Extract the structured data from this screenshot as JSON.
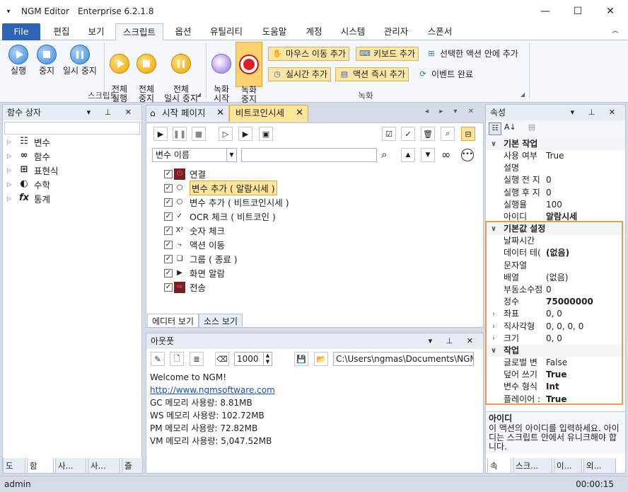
{
  "window": {
    "app": "NGM Editor",
    "edition": "Enterprise 6.2.1.8",
    "menu_icon": "dropdown-icon"
  },
  "menu": {
    "tabs": [
      "File",
      "편집",
      "보기",
      "스크립트",
      "옵션",
      "유틸리티",
      "도움말",
      "계정",
      "시스템",
      "관리자",
      "스폰서"
    ],
    "active": "스크립트"
  },
  "ribbon": {
    "script": {
      "run": "실행",
      "stop": "중지",
      "pause": "일시 중지",
      "run_all": "전체\n실행",
      "stop_all": "전체\n중지",
      "pause_all": "전체\n일시 중지",
      "group": "스크립트"
    },
    "record": {
      "start": "녹화\n시작",
      "stop": "녹화\n중지",
      "mouse": "마우스 이동 추가",
      "keyboard": "키보드 추가",
      "inside": "선택한 액션 안에 추가",
      "realtime": "실시간 추가",
      "instant": "액션 즉시 추가",
      "event_done": "이벤트 완료",
      "group": "녹화"
    }
  },
  "left_panel": {
    "title": "함수 상자",
    "items": [
      {
        "label": "변수",
        "icon": "variable-icon"
      },
      {
        "label": "함수",
        "icon": "function-icon"
      },
      {
        "label": "표현식",
        "icon": "expression-icon"
      },
      {
        "label": "수학",
        "icon": "math-icon"
      },
      {
        "label": "통계",
        "icon": "statistics-icon"
      }
    ],
    "bottom_tabs": [
      "도",
      "함",
      "사...",
      "사...",
      "즐"
    ]
  },
  "doc_tabs": [
    {
      "label": "시작 페이지",
      "icon": "home-icon"
    },
    {
      "label": "비트코인시세",
      "icon": ""
    }
  ],
  "editor": {
    "var_select": "변수 이름",
    "search_value": "",
    "lines": [
      {
        "label": "연결",
        "icon": "connect-icon",
        "checked": true,
        "highlight": false
      },
      {
        "label": "변수 추가 ( 알람시세 )",
        "icon": "cube-icon",
        "checked": true,
        "highlight": true
      },
      {
        "label": "변수 추가 ( 비트코인시세 )",
        "icon": "cube-icon",
        "checked": true,
        "highlight": false
      },
      {
        "label": "OCR 체크 ( 비트코인 )",
        "icon": "ocr-icon",
        "checked": true,
        "highlight": false
      },
      {
        "label": "숫자 체크",
        "icon": "number-check-icon",
        "checked": true,
        "highlight": false
      },
      {
        "label": "액션 이동",
        "icon": "action-move-icon",
        "checked": true,
        "highlight": false
      },
      {
        "label": "그룹 ( 종료 )",
        "icon": "group-icon",
        "checked": true,
        "highlight": false
      },
      {
        "label": "화면 알람",
        "icon": "screen-alarm-icon",
        "checked": true,
        "highlight": false
      },
      {
        "label": "전송",
        "icon": "send-icon",
        "checked": true,
        "highlight": false
      }
    ],
    "view_tabs": [
      "에디터 보기",
      "소스 보기"
    ]
  },
  "output": {
    "title": "아웃풋",
    "limit": "1000",
    "path": "C:\\Users\\ngmas\\Documents\\NGM6\\",
    "lines": [
      "Welcome to NGM!",
      "http://www.ngmsoftware.com",
      "GC 메모리 사용량: 8.81MB",
      "WS 메모리 사용량: 102.72MB",
      "PM 메모리 사용량: 72.82MB",
      "VM 메모리 사용량: 5,047.52MB"
    ]
  },
  "properties": {
    "title": "속성",
    "cat1": "기본 작업",
    "basic": [
      {
        "n": "사용 여부",
        "v": "True"
      },
      {
        "n": "설명",
        "v": ""
      },
      {
        "n": "실행 전 지",
        "v": "0"
      },
      {
        "n": "실행 후 지",
        "v": "0"
      },
      {
        "n": "실행율",
        "v": "100"
      },
      {
        "n": "아이디",
        "v": "알람시세"
      }
    ],
    "cat2": "기본값 설정",
    "defaults": [
      {
        "n": "날짜시간",
        "v": ""
      },
      {
        "n": "데이터 테(",
        "v": "(없음)"
      },
      {
        "n": "문자열",
        "v": ""
      },
      {
        "n": "배열",
        "v": "(없음)"
      },
      {
        "n": "부동소수점",
        "v": "0"
      },
      {
        "n": "정수",
        "v": "75000000"
      },
      {
        "n": "좌표",
        "v": "0, 0"
      },
      {
        "n": "직사각형",
        "v": "0, 0, 0, 0"
      },
      {
        "n": "크기",
        "v": "0, 0"
      }
    ],
    "cat3": "작업",
    "task": [
      {
        "n": "글로벌 변",
        "v": "False"
      },
      {
        "n": "덮어 쓰기",
        "v": "True"
      },
      {
        "n": "변수 형식",
        "v": "Int"
      },
      {
        "n": "플레이어 :",
        "v": "True"
      }
    ],
    "desc_title": "아이디",
    "desc_text": "이 액션의 아이디를 입력하세요. 아이디는 스크립트 안에서 유니크해야 합니다.",
    "bottom_tabs": [
      "속",
      "스크...",
      "이...",
      "외..."
    ]
  },
  "status": {
    "user": "admin",
    "time": "00:00:15"
  }
}
